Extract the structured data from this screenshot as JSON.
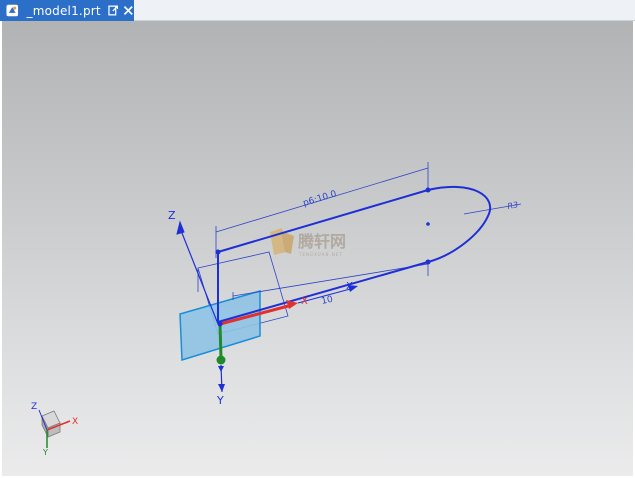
{
  "tab": {
    "label": "_model1.prt",
    "app_icon": "part-file-icon",
    "float_icon": "float-window-icon",
    "close_icon": "close-icon"
  },
  "dimensions": {
    "length": "p6:10.0",
    "width": "10",
    "radius": "R3"
  },
  "axes": {
    "x": "X",
    "y": "Y",
    "z": "Z"
  },
  "triad": {
    "x": "X",
    "y": "Y",
    "z": "Z"
  },
  "watermark": {
    "text": "腾轩网",
    "sub": "TENGXUAN.NET"
  },
  "colors": {
    "tab": "#2b6fc9",
    "sketch": "#1f2fd6",
    "dimension": "#2e44c8",
    "plane_fill": "#8fc3e6",
    "plane_edge": "#1a8ed6",
    "x_axis": "#e03030",
    "y_axis": "#1f8a2a",
    "z_axis": "#1f2fd6"
  }
}
